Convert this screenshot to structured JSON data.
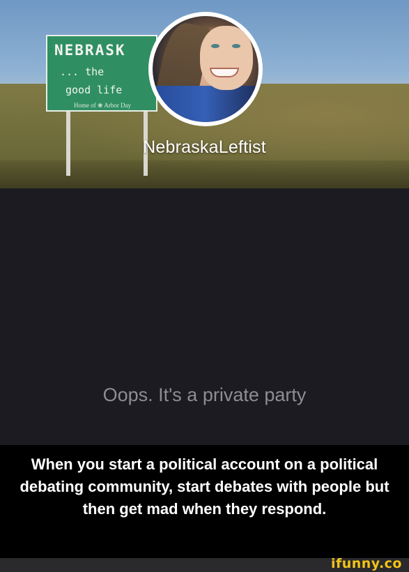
{
  "profile": {
    "username": "NebraskaLeftist",
    "private_message": "Oops. It's a private party"
  },
  "cover_sign": {
    "state": "NEBRASK",
    "line1": "... the",
    "line2": "good life",
    "line3": "Home of ❀ Arbor Day"
  },
  "caption": {
    "text": "When you start a political account on a political debating community, start debates with people but then get mad when they respond."
  },
  "watermark": {
    "text": "ifunny.co"
  },
  "colors": {
    "background": "#1c1b22",
    "caption_bg": "#000000",
    "watermark": "#f2c318",
    "sign_green": "#2f8f62"
  }
}
